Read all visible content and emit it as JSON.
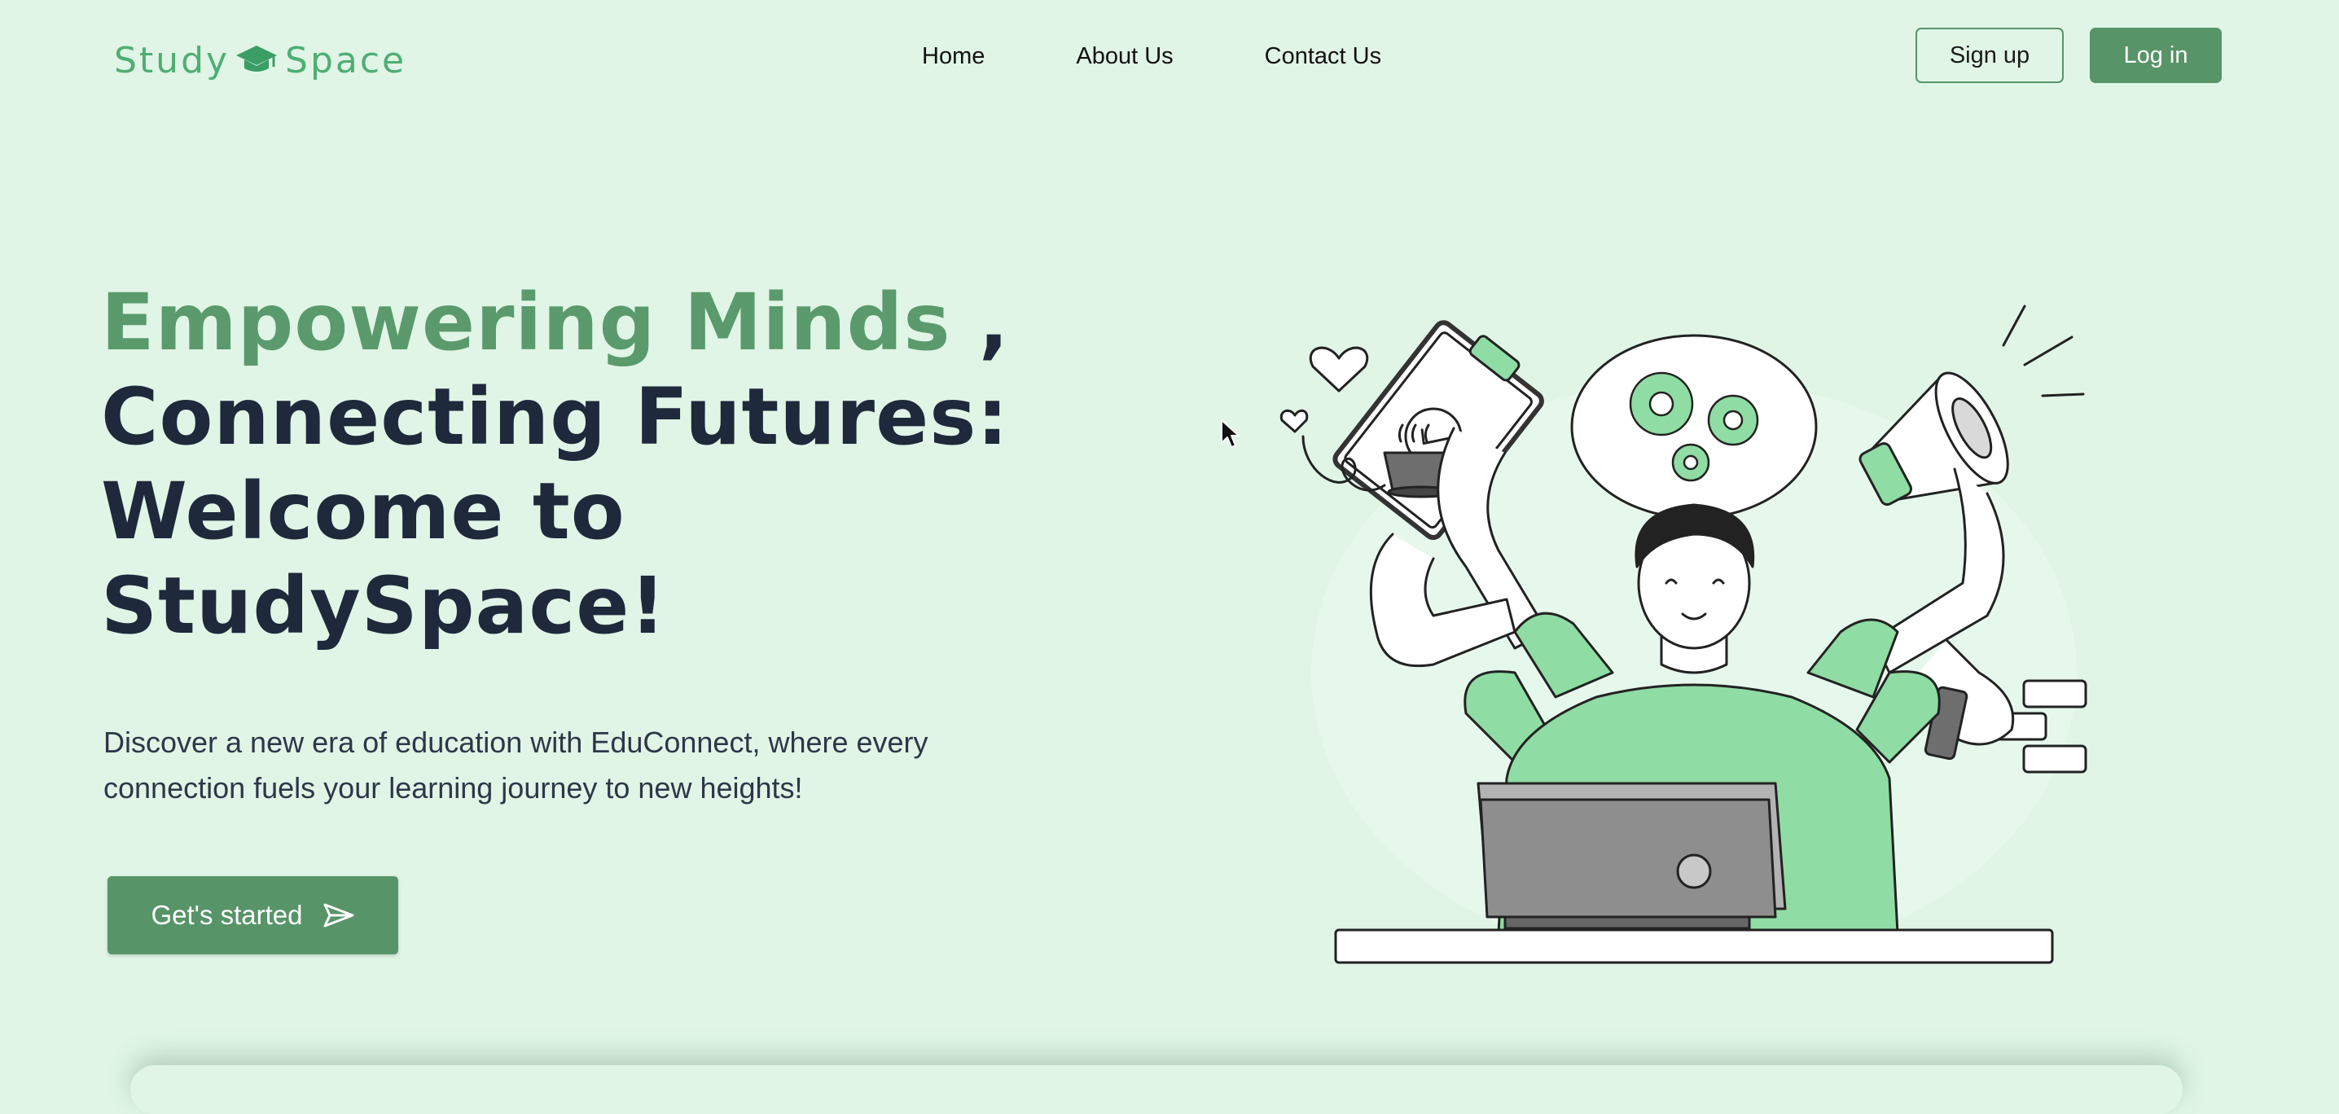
{
  "logo": {
    "left": "Study",
    "right": "Space"
  },
  "nav": {
    "links": [
      "Home",
      "About Us",
      "Contact Us"
    ]
  },
  "auth": {
    "signup": "Sign up",
    "login": "Log in"
  },
  "hero": {
    "title_accent": "Empowering Minds",
    "title_comma": " ,",
    "title_line2": "Connecting Futures:",
    "title_line3": "Welcome to",
    "title_line4": "StudySpace!",
    "subtitle": "Discover a new era of education with EduConnect, where every connection fuels your learning journey to new heights!",
    "cta": "Get's started"
  },
  "icons": [
    "graduation-cap-icon",
    "send-arrow-icon",
    "mouse-cursor-icon"
  ],
  "colors": {
    "background": "#e0f5e6",
    "primary": "#579468",
    "accent_text": "#5a9a6c",
    "logo": "#4fae74",
    "heading": "#1e293b"
  }
}
